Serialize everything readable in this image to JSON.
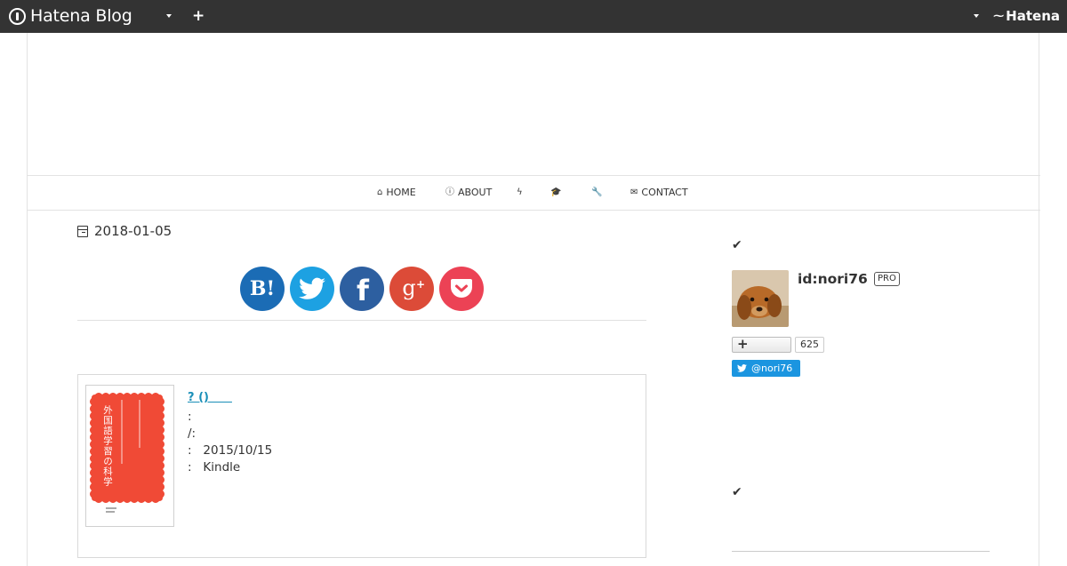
{
  "topbar": {
    "brand": "Hatena Blog",
    "add_label": "+",
    "logo": "Hatena"
  },
  "nav": [
    {
      "icon": "home-icon",
      "glyph": "⌂",
      "label": "HOME"
    },
    {
      "icon": "info-icon",
      "glyph": "ⓘ",
      "label": "ABOUT"
    },
    {
      "icon": "bolt-icon",
      "glyph": "ϟ",
      "label": ""
    },
    {
      "icon": "graduation-cap-icon",
      "glyph": "🎓",
      "label": ""
    },
    {
      "icon": "wrench-icon",
      "glyph": "🔧",
      "label": ""
    },
    {
      "icon": "envelope-icon",
      "glyph": "✉",
      "label": "CONTACT"
    }
  ],
  "post": {
    "date": "2018-01-05"
  },
  "share": [
    {
      "icon": "hatena-bookmark-icon",
      "color": "#1b6cb5"
    },
    {
      "icon": "twitter-icon",
      "color": "#1da1e2"
    },
    {
      "icon": "facebook-icon",
      "color": "#2d5fa0"
    },
    {
      "icon": "google-plus-icon",
      "color": "#dc4b38"
    },
    {
      "icon": "pocket-icon",
      "color": "#ec4255"
    }
  ],
  "book": {
    "title": "? ()　　",
    "lines": [
      ":",
      "/:",
      ":   2015/10/15",
      ":   Kindle"
    ],
    "cover_title": "外国語学習の科学",
    "cover_color": "#f04a36"
  },
  "profile": {
    "id": "id:nori76",
    "badge": "PRO",
    "follow_label": "+",
    "followers": "625",
    "twitter": "@nori76"
  },
  "sidebar": {
    "check1": "✔",
    "check2": "✔"
  }
}
